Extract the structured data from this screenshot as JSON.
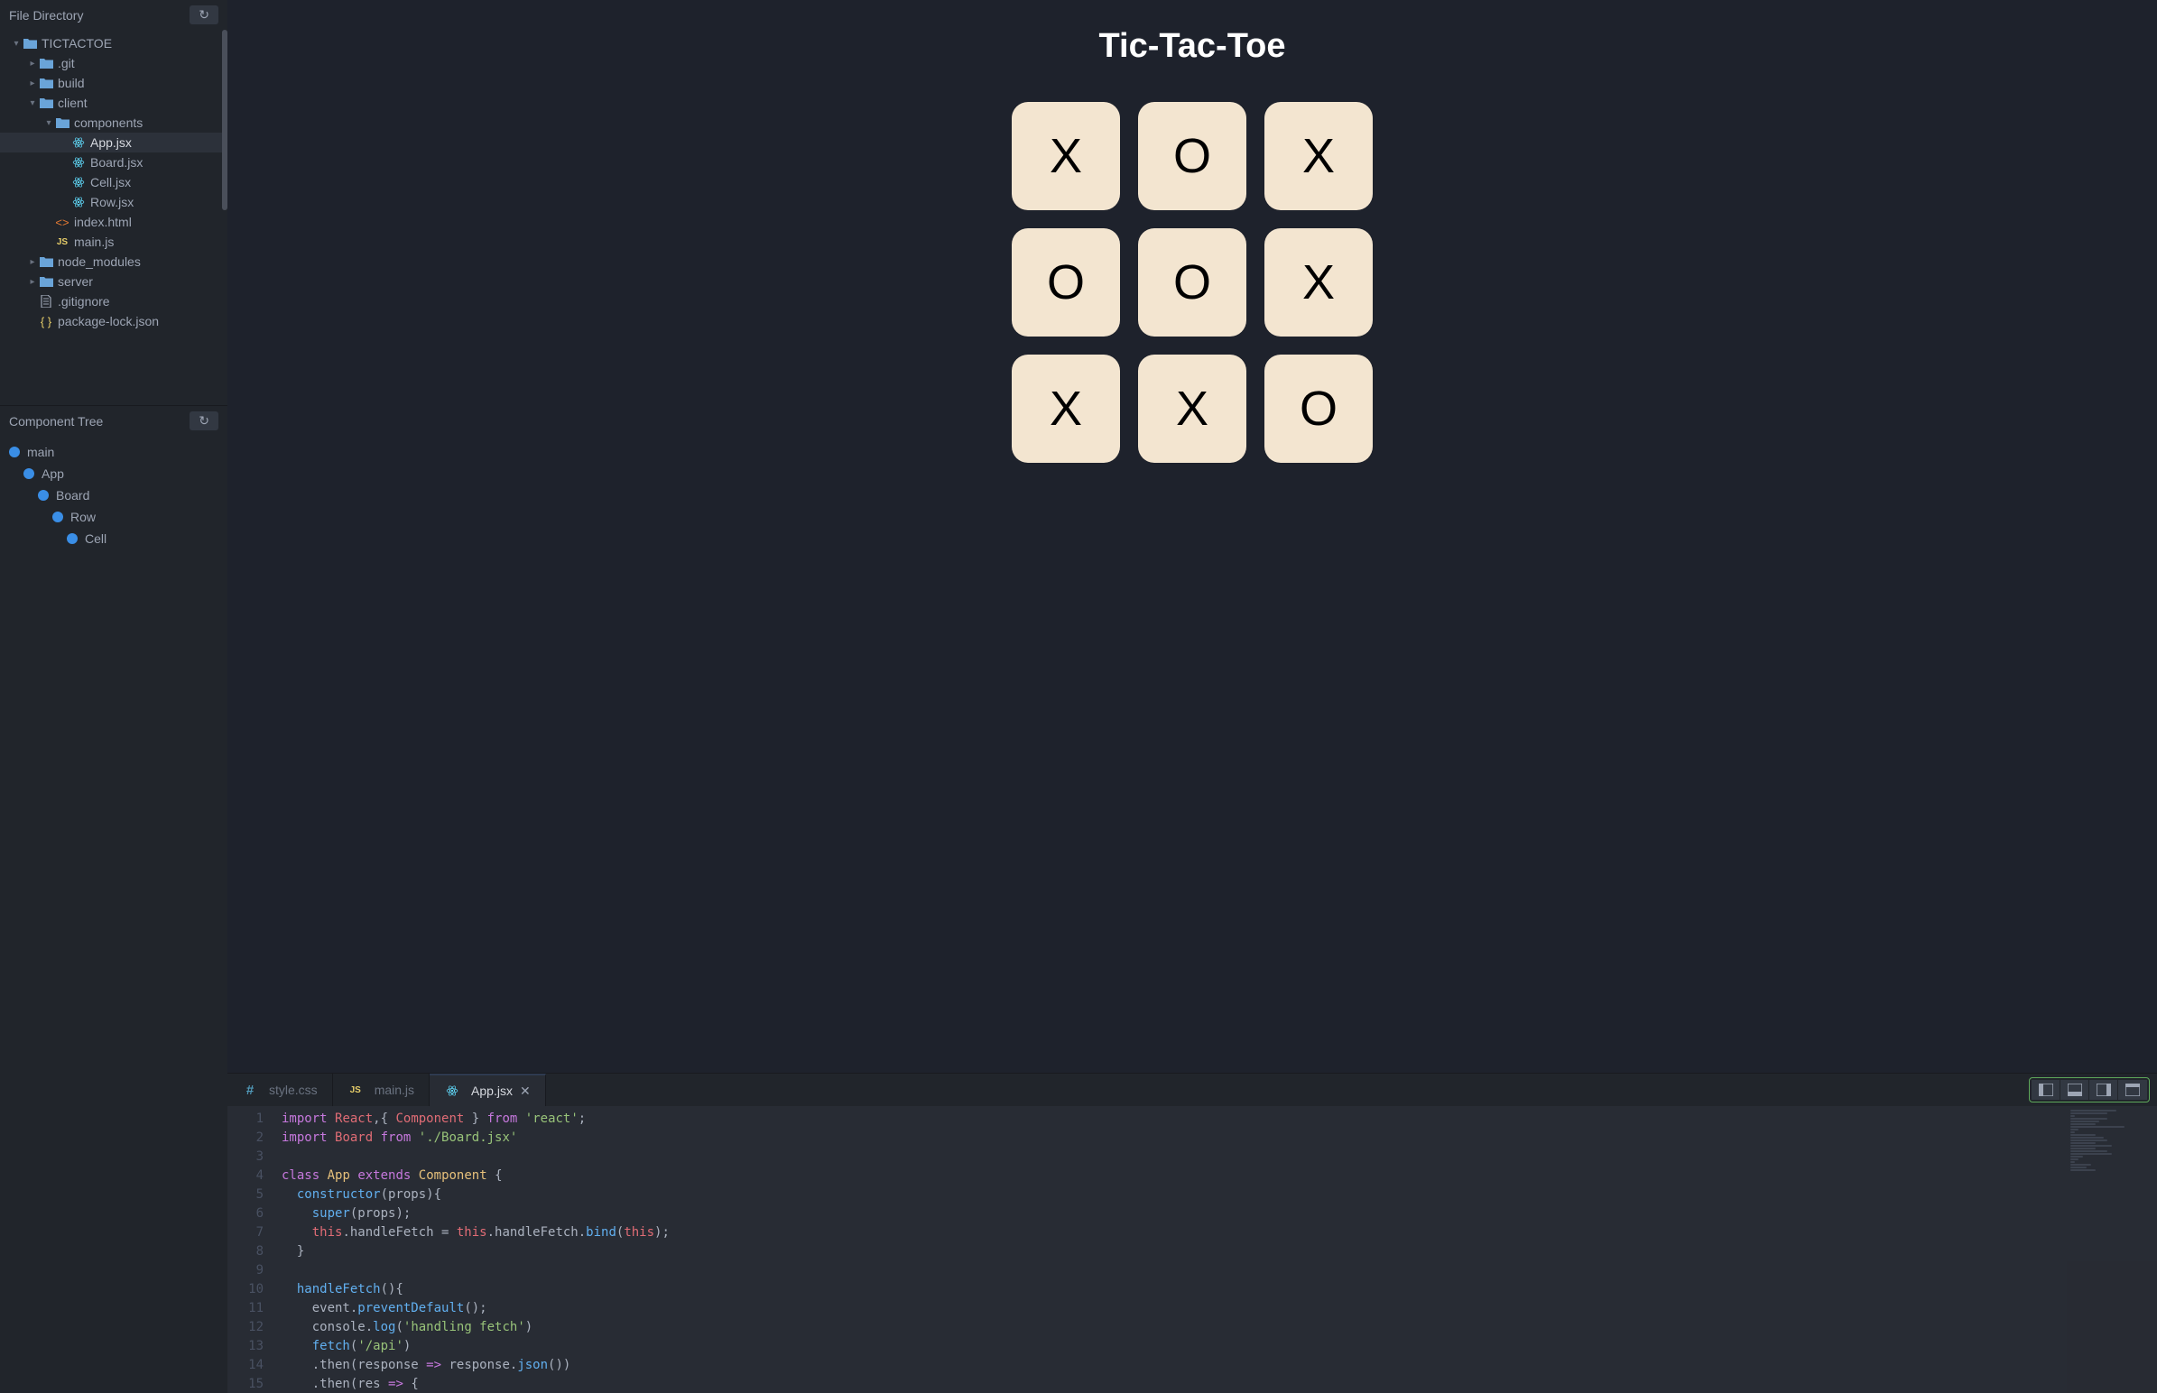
{
  "sidebar": {
    "file_directory_title": "File Directory",
    "component_tree_title": "Component Tree",
    "refresh_icon_label": "↻"
  },
  "file_tree": {
    "root": "TICTACTOE",
    "items": [
      {
        "name": ".git",
        "type": "folder",
        "expanded": false,
        "depth": 1
      },
      {
        "name": "build",
        "type": "folder",
        "expanded": false,
        "depth": 1
      },
      {
        "name": "client",
        "type": "folder",
        "expanded": true,
        "depth": 1
      },
      {
        "name": "components",
        "type": "folder",
        "expanded": true,
        "depth": 2
      },
      {
        "name": "App.jsx",
        "type": "react",
        "depth": 3,
        "selected": true
      },
      {
        "name": "Board.jsx",
        "type": "react",
        "depth": 3
      },
      {
        "name": "Cell.jsx",
        "type": "react",
        "depth": 3
      },
      {
        "name": "Row.jsx",
        "type": "react",
        "depth": 3
      },
      {
        "name": "index.html",
        "type": "html",
        "depth": 2
      },
      {
        "name": "main.js",
        "type": "js",
        "depth": 2
      },
      {
        "name": "node_modules",
        "type": "folder",
        "expanded": false,
        "depth": 1
      },
      {
        "name": "server",
        "type": "folder",
        "expanded": false,
        "depth": 1
      },
      {
        "name": ".gitignore",
        "type": "file",
        "depth": 1
      },
      {
        "name": "package-lock.json",
        "type": "json",
        "depth": 1
      }
    ]
  },
  "component_tree": [
    {
      "name": "main",
      "depth": 0
    },
    {
      "name": "App",
      "depth": 1
    },
    {
      "name": "Board",
      "depth": 2
    },
    {
      "name": "Row",
      "depth": 3
    },
    {
      "name": "Cell",
      "depth": 4
    }
  ],
  "preview": {
    "title": "Tic-Tac-Toe",
    "cells": [
      "X",
      "O",
      "X",
      "O",
      "O",
      "X",
      "X",
      "X",
      "O"
    ]
  },
  "editor": {
    "tabs": [
      {
        "label": "style.css",
        "icon": "hash",
        "active": false
      },
      {
        "label": "main.js",
        "icon": "js",
        "active": false
      },
      {
        "label": "App.jsx",
        "icon": "react",
        "active": true,
        "closable": true
      }
    ],
    "close_icon": "✕",
    "line_numbers": [
      "1",
      "2",
      "3",
      "4",
      "5",
      "6",
      "7",
      "8",
      "9",
      "10",
      "11",
      "12",
      "13",
      "14",
      "15"
    ],
    "code": {
      "l1_import": "import",
      "l1_react": "React",
      "l1_comma": ",{ ",
      "l1_component": "Component",
      "l1_brace": " } ",
      "l1_from": "from",
      "l1_str": "'react'",
      "l1_semi": ";",
      "l2_import": "import",
      "l2_board": "Board",
      "l2_from": "from",
      "l2_str": "'./Board.jsx'",
      "l4_class": "class",
      "l4_app": "App",
      "l4_extends": "extends",
      "l4_component": "Component",
      "l4_brace": " {",
      "l5_constructor": "constructor",
      "l5_props": "(props){",
      "l6_super": "super",
      "l6_props": "(props);",
      "l7_this1": "this",
      "l7_hf": ".handleFetch = ",
      "l7_this2": "this",
      "l7_hf2": ".handleFetch.",
      "l7_bind": "bind",
      "l7_this3": "(this",
      "l7_end": ");",
      "l8_brace": "}",
      "l10_hf": "handleFetch",
      "l10_paren": "(){",
      "l11_event": "event.",
      "l11_pd": "preventDefault",
      "l11_end": "();",
      "l12_console": "console.",
      "l12_log": "log",
      "l12_paren": "(",
      "l12_str": "'handling fetch'",
      "l12_end": ")",
      "l13_fetch": "fetch",
      "l13_paren": "(",
      "l13_str": "'/api'",
      "l13_end": ")",
      "l14_then": ".then",
      "l14_resp": "(response ",
      "l14_arrow": "=>",
      "l14_resp2": " response.",
      "l14_json": "json",
      "l14_end": "())",
      "l15_then": ".then",
      "l15_res": "(res ",
      "l15_arrow": "=>",
      "l15_brace": " {"
    }
  }
}
